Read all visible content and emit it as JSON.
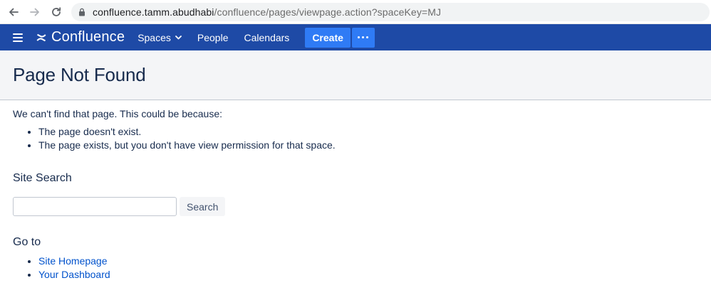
{
  "browser": {
    "url_host": "confluence.tamm.abudhabi",
    "url_path": "/confluence/pages/viewpage.action?spaceKey=MJ"
  },
  "header": {
    "logo_text": "Confluence",
    "nav": {
      "spaces": "Spaces",
      "people": "People",
      "calendars": "Calendars"
    },
    "create_label": "Create"
  },
  "page": {
    "title": "Page Not Found",
    "intro": "We can't find that page. This could be because:",
    "reasons": [
      "The page doesn't exist.",
      "The page exists, but you don't have view permission for that space."
    ],
    "search_heading": "Site Search",
    "search_value": "",
    "search_button": "Search",
    "goto_heading": "Go to",
    "links": [
      "Site Homepage",
      "Your Dashboard"
    ]
  },
  "colors": {
    "header_bg": "#1e4aa6",
    "create_bg": "#2f7bf5",
    "link": "#0052cc",
    "banner_bg": "#f4f5f7"
  }
}
